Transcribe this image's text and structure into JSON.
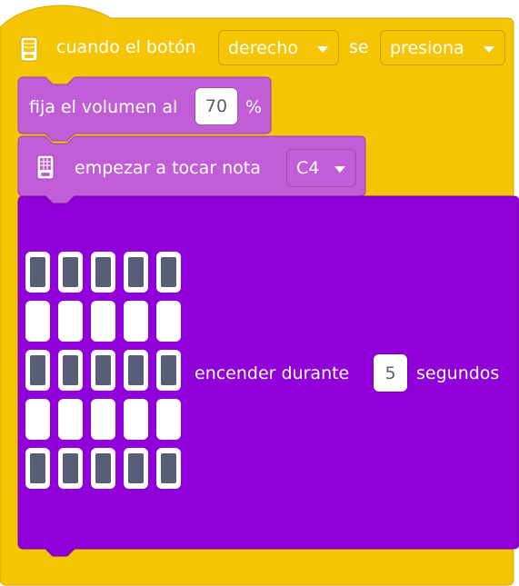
{
  "hat_block": {
    "text_when": "cuando el botón",
    "button_dropdown": "derecho",
    "text_is": "se",
    "action_dropdown": "presiona"
  },
  "volume_block": {
    "text_prefix": "fija el volumen al",
    "value": "70",
    "text_suffix": "%"
  },
  "note_block": {
    "text": "empezar a tocar nota",
    "note_dropdown": "C4"
  },
  "light_block": {
    "matrix_rows": [
      [
        1,
        1,
        1,
        1,
        1
      ],
      [
        0,
        0,
        0,
        0,
        0
      ],
      [
        1,
        1,
        1,
        1,
        1
      ],
      [
        0,
        0,
        0,
        0,
        0
      ],
      [
        1,
        1,
        1,
        1,
        1
      ]
    ],
    "text_prefix": "encender durante",
    "value": "5",
    "text_suffix": "segundos"
  },
  "colors": {
    "events_yellow": "#f5c402",
    "sound_purple": "#c15ed7",
    "light_purple": "#9000d9",
    "led_on": "#575e75"
  }
}
